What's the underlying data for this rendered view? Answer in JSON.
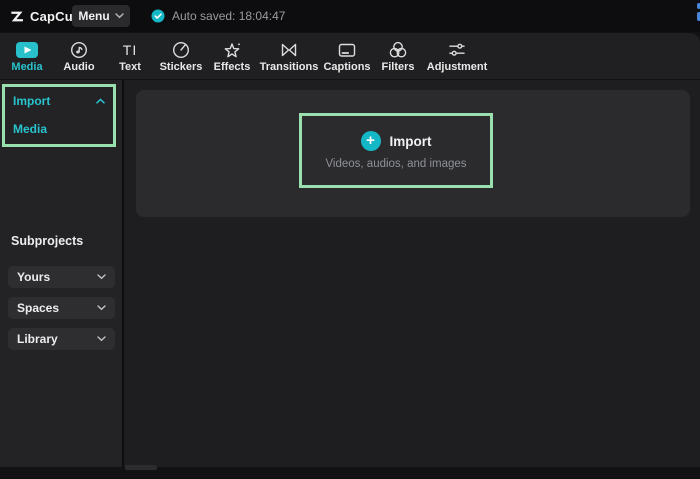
{
  "topbar": {
    "logo_text": "CapCut",
    "menu_label": "Menu",
    "autosave_text": "Auto saved: 18:04:47"
  },
  "toolbar": {
    "tabs": [
      {
        "label": "Media",
        "icon": "media-play-icon",
        "active": true
      },
      {
        "label": "Audio",
        "icon": "audio-disc-icon",
        "active": false
      },
      {
        "label": "Text",
        "icon": "text-ti-icon",
        "active": false
      },
      {
        "label": "Stickers",
        "icon": "sticker-icon",
        "active": false
      },
      {
        "label": "Effects",
        "icon": "effects-star-icon",
        "active": false
      },
      {
        "label": "Transitions",
        "icon": "transitions-icon",
        "active": false
      },
      {
        "label": "Captions",
        "icon": "captions-icon",
        "active": false
      },
      {
        "label": "Filters",
        "icon": "filters-icon",
        "active": false
      },
      {
        "label": "Adjustment",
        "icon": "adjustment-icon",
        "active": false
      }
    ]
  },
  "sidebar": {
    "import_label": "Import",
    "media_label": "Media",
    "subprojects_label": "Subprojects",
    "dropdowns": [
      {
        "label": "Yours"
      },
      {
        "label": "Spaces"
      },
      {
        "label": "Library"
      }
    ]
  },
  "main": {
    "import_button_label": "Import",
    "plus_glyph": "+",
    "import_subtitle": "Videos, audios, and images"
  },
  "colors": {
    "accent_cyan": "#28c3cd",
    "teal_circle": "#14b7c6",
    "annotation_green": "#9adfae",
    "panel_dark": "#202023",
    "card_gray": "#2b2b2e"
  }
}
